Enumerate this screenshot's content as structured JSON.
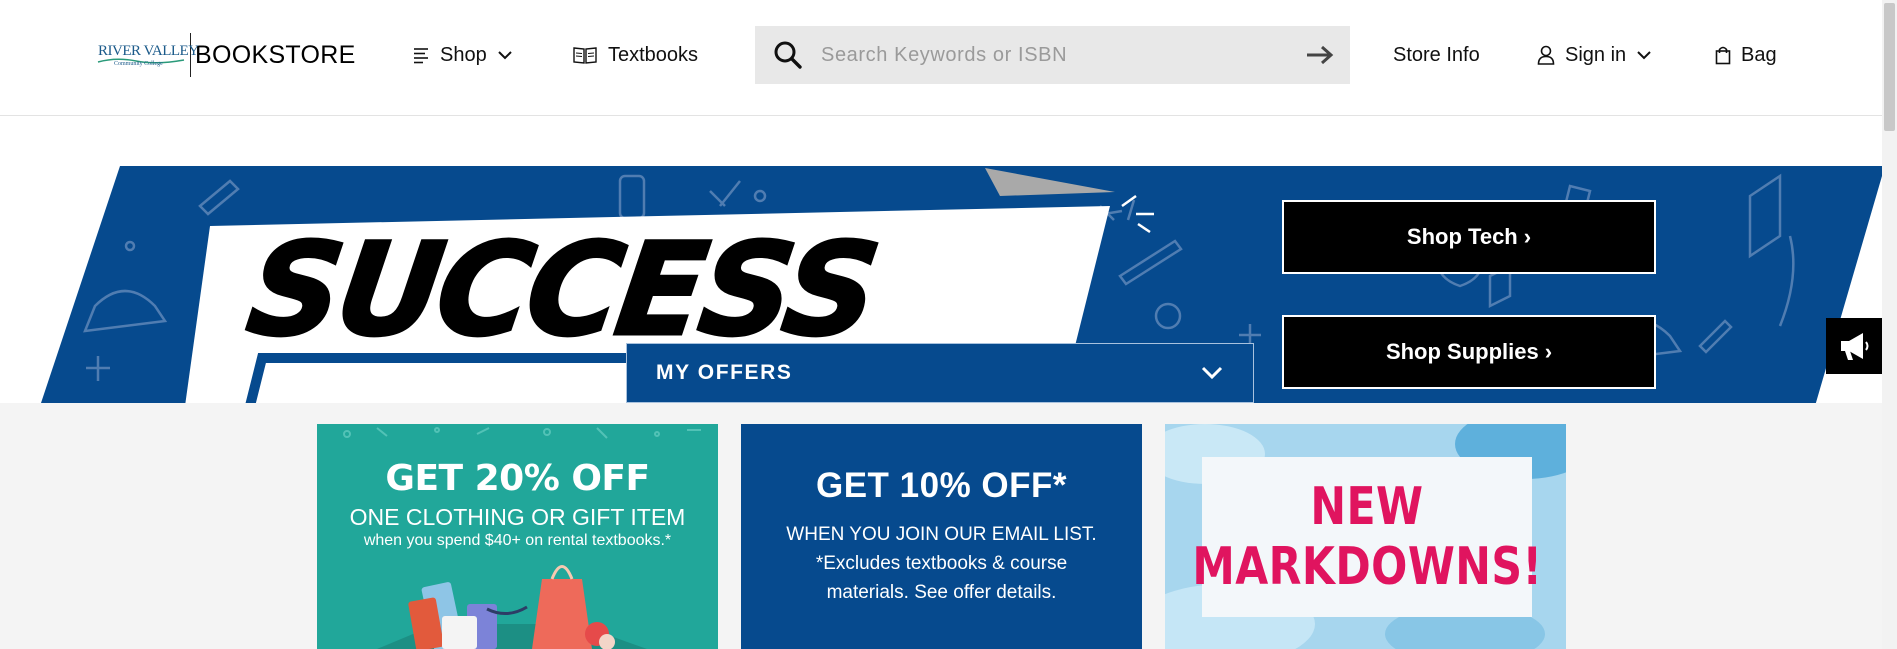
{
  "header": {
    "logo": {
      "mark_line1": "RIVER VALLEY",
      "mark_line2": "Community College",
      "text": "BOOKSTORE"
    },
    "nav": {
      "shop": "Shop",
      "textbooks": "Textbooks",
      "store_info": "Store Info",
      "sign_in": "Sign in",
      "bag": "Bag"
    },
    "search": {
      "placeholder": "Search Keywords or ISBN",
      "value": ""
    }
  },
  "hero": {
    "headline": "SUCCESS",
    "buttons": {
      "tech": "Shop Tech",
      "supplies": "Shop Supplies"
    },
    "chevron": "›"
  },
  "offers": {
    "title": "MY OFFERS",
    "cards": [
      {
        "headline": "GET 20% OFF",
        "subline": "ONE CLOTHING OR GIFT ITEM",
        "fine_print": "when you spend $40+ on rental textbooks.*"
      },
      {
        "headline": "GET 10% OFF*",
        "line1": "WHEN YOU JOIN OUR EMAIL LIST.",
        "line2": "*Excludes textbooks & course",
        "line3": "materials. See offer details."
      },
      {
        "line1": "NEW",
        "line2": "MARKDOWNS!"
      }
    ]
  },
  "colors": {
    "brand_blue": "#064a8e",
    "teal": "#21a79a",
    "markdown_pink": "#e0145f",
    "search_bg": "#e8e8e8"
  },
  "icons": [
    "menu-lines-icon",
    "chevron-down-icon",
    "open-book-icon",
    "search-icon",
    "arrow-right-icon",
    "user-icon",
    "shopping-bag-icon",
    "megaphone-icon"
  ]
}
